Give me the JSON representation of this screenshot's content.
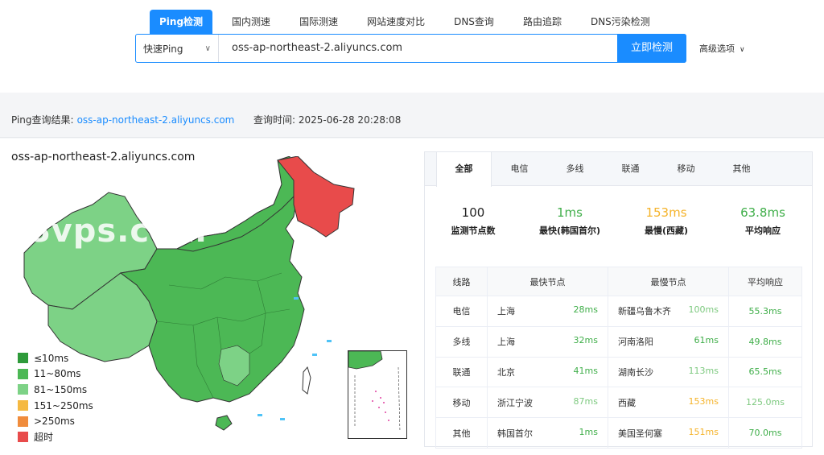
{
  "nav": {
    "tabs": [
      "Ping检测",
      "国内测速",
      "国际测速",
      "网站速度对比",
      "DNS查询",
      "路由追踪",
      "DNS污染检测"
    ]
  },
  "search": {
    "mode": "快速Ping",
    "host": "oss-ap-northeast-2.aliyuncs.com",
    "submit": "立即检测",
    "advanced": "高级选项"
  },
  "result": {
    "label": "Ping查询结果:",
    "host": "oss-ap-northeast-2.aliyuncs.com",
    "time_label": "查询时间:",
    "time": "2025-06-28 20:28:08"
  },
  "map": {
    "title": "oss-ap-northeast-2.aliyuncs.com",
    "watermark": "18vps.com",
    "legend": [
      {
        "label": "≤10ms",
        "color": "#2e9a3a"
      },
      {
        "label": "11~80ms",
        "color": "#4cb855"
      },
      {
        "label": "81~150ms",
        "color": "#7dd286"
      },
      {
        "label": "151~250ms",
        "color": "#f5b942"
      },
      {
        "label": ">250ms",
        "color": "#f08c3c"
      },
      {
        "label": "超时",
        "color": "#e84b4b"
      }
    ]
  },
  "panel": {
    "tabs": [
      "全部",
      "电信",
      "多线",
      "联通",
      "移动",
      "其他"
    ],
    "stats": [
      {
        "value": "100",
        "label": "监测节点数",
        "color": "#222222"
      },
      {
        "value": "1ms",
        "label": "最快(韩国首尔)",
        "color": "#3fae49"
      },
      {
        "value": "153ms",
        "label": "最慢(西藏)",
        "color": "#f5b32a"
      },
      {
        "value": "63.8ms",
        "label": "平均响应",
        "color": "#3fae49"
      }
    ],
    "table": {
      "headers": [
        "线路",
        "最快节点",
        "最慢节点",
        "平均响应"
      ],
      "rows": [
        {
          "line": "电信",
          "fast": "上海",
          "fast_ms": "28ms",
          "slow": "新疆乌鲁木齐",
          "slow_ms": "100ms",
          "avg": "55.3ms",
          "fast_color": "#3fae49",
          "slow_color": "#7dc97f",
          "avg_color": "#3fae49"
        },
        {
          "line": "多线",
          "fast": "上海",
          "fast_ms": "32ms",
          "slow": "河南洛阳",
          "slow_ms": "61ms",
          "avg": "49.8ms",
          "fast_color": "#3fae49",
          "slow_color": "#3fae49",
          "avg_color": "#3fae49"
        },
        {
          "line": "联通",
          "fast": "北京",
          "fast_ms": "41ms",
          "slow": "湖南长沙",
          "slow_ms": "113ms",
          "avg": "65.5ms",
          "fast_color": "#3fae49",
          "slow_color": "#7dc97f",
          "avg_color": "#3fae49"
        },
        {
          "line": "移动",
          "fast": "浙江宁波",
          "fast_ms": "87ms",
          "slow": "西藏",
          "slow_ms": "153ms",
          "avg": "125.0ms",
          "fast_color": "#7dc97f",
          "slow_color": "#f5b32a",
          "avg_color": "#7dc97f"
        },
        {
          "line": "其他",
          "fast": "韩国首尔",
          "fast_ms": "1ms",
          "slow": "美国圣何塞",
          "slow_ms": "151ms",
          "avg": "70.0ms",
          "fast_color": "#3fae49",
          "slow_color": "#f5b32a",
          "avg_color": "#3fae49"
        }
      ]
    }
  }
}
